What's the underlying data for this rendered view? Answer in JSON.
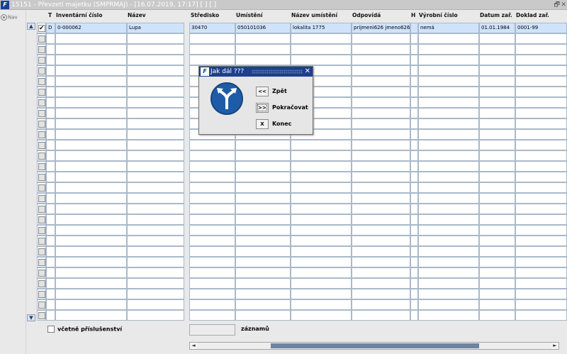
{
  "window": {
    "logo": "F",
    "title": "15151 - Převzetí majetku (SMPRMAJ) - [16.07.2019, 17:17]  [  ]  [  ]",
    "restore": "🗗",
    "close": "✕"
  },
  "nav": {
    "label": "Nav"
  },
  "columns": {
    "t": "T",
    "inv": "Inventární číslo",
    "nazev": "Název",
    "stredisko": "Středisko",
    "umisteni": "Umístění",
    "nazev_umisteni": "Název umístění",
    "odpovida": "Odpovídá",
    "h": "H",
    "vyrobni": "Výrobní číslo",
    "datum": "Datum zař.",
    "doklad": "Doklad zař."
  },
  "rows": [
    {
      "checked": true,
      "t": "D",
      "inv": "0-000062",
      "nazev": "Lupa",
      "stredisko": "30470",
      "umisteni": "050101036",
      "nazev_umisteni": "lokalita 1775",
      "odpovida": "prijmeni626 jmeno626",
      "h": "",
      "vyrobni": "nemá",
      "datum": "01.01.1984",
      "doklad": "0001-99"
    }
  ],
  "scroll": {
    "up": "▲",
    "down": "▼",
    "left": "◄",
    "right": "►"
  },
  "dialog": {
    "logo": "F",
    "title": "Jak dál ???",
    "close": "✕",
    "buttons": [
      {
        "key": "<<",
        "label": "Zpět"
      },
      {
        "key": ">>",
        "label": "Pokračovat"
      },
      {
        "key": "X",
        "label": "Konec"
      }
    ]
  },
  "footer": {
    "include_label": "včetně příslušenství",
    "count_value": "",
    "records_label": "záznamů"
  },
  "colors": {
    "selected_row": "#cfe3fb",
    "grid_border": "#a9b9c9",
    "dialog_title": "#1d3e8f"
  }
}
